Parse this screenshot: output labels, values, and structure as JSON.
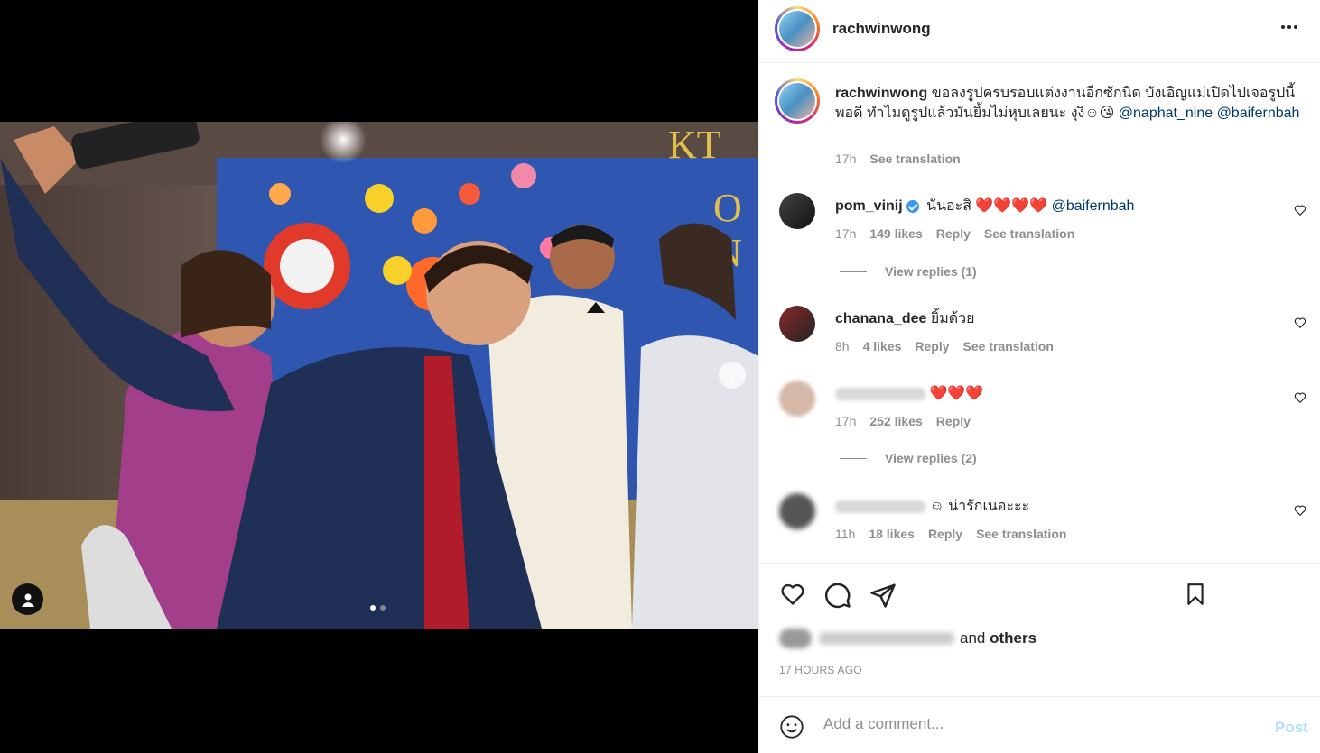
{
  "post": {
    "username": "rachwinwong",
    "caption_text": "ขอลงรูปครบรอบแต่งงานอีกซักนิด บังเอิญแม่เปิดไปเจอรูปนี้พอดี ทำไมดูรูปแล้วมันยิ้มไม่หุบเลยนะ งุงิ☺😘",
    "caption_mention_1": "@naphat_nine",
    "caption_mention_2": "@baifernbah",
    "caption_time": "17h",
    "see_translation": "See translation",
    "photo_text": "KITTY ON"
  },
  "comments": [
    {
      "username": "pom_vinij",
      "verified": true,
      "text": "นั่นอะสิ ❤️❤️❤️❤️",
      "mention": "@baifernbah",
      "time": "17h",
      "likes": "149 likes",
      "reply": "Reply",
      "translate": "See translation",
      "view_replies": "View replies (1)"
    },
    {
      "username": "chanana_dee",
      "text": "ยิ้มด้วย",
      "time": "8h",
      "likes": "4 likes",
      "reply": "Reply",
      "translate": "See translation"
    },
    {
      "username_blurred": true,
      "text": "❤️❤️❤️",
      "time": "17h",
      "likes": "252 likes",
      "reply": "Reply",
      "view_replies": "View replies (2)"
    },
    {
      "username_blurred": true,
      "text": "☺ น่ารักเนอะะะ",
      "time": "11h",
      "likes": "18 likes",
      "reply": "Reply",
      "translate": "See translation"
    }
  ],
  "likes": {
    "suffix": "and",
    "others": "others"
  },
  "timestamp": "17 HOURS AGO",
  "add_comment": {
    "placeholder": "Add a comment...",
    "post_label": "Post"
  },
  "icons": {
    "like": "heart-icon",
    "comment": "comment-bubble-icon",
    "share": "paper-plane-icon",
    "save": "bookmark-icon",
    "emoji": "smiley-icon",
    "more": "more-dots-icon",
    "next": "chevron-right-icon",
    "user_tag": "user-tag-icon"
  },
  "colors": {
    "link": "#00376b",
    "muted": "#8e8e8e",
    "post_disabled": "#b2dffc",
    "verified": "#3897f0"
  }
}
